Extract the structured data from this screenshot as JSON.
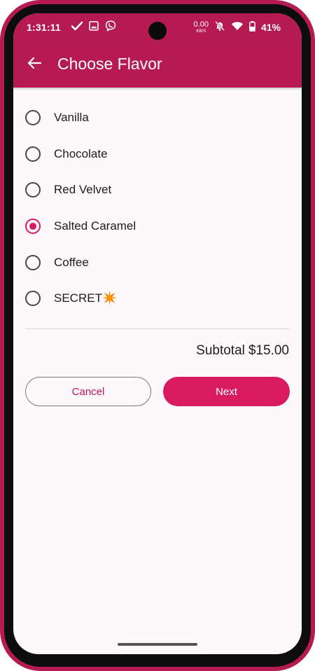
{
  "status_bar": {
    "time": "1:31:11",
    "net_speed_value": "0.00",
    "net_speed_unit": "KB/S",
    "battery": "41%",
    "icons": [
      "check-icon",
      "image-icon",
      "viber-icon",
      "mute-icon",
      "wifi-icon",
      "battery-icon"
    ]
  },
  "app_bar": {
    "title": "Choose Flavor",
    "back_icon": "arrow-back-icon"
  },
  "flavors": {
    "options": [
      {
        "label": "Vanilla",
        "selected": false
      },
      {
        "label": "Chocolate",
        "selected": false
      },
      {
        "label": "Red Velvet",
        "selected": false
      },
      {
        "label": "Salted Caramel",
        "selected": true
      },
      {
        "label": "Coffee",
        "selected": false
      },
      {
        "label": "SECRET✴️",
        "selected": false
      }
    ]
  },
  "summary": {
    "subtotal_label": "Subtotal",
    "subtotal_value": "$15.00"
  },
  "actions": {
    "cancel_label": "Cancel",
    "next_label": "Next"
  },
  "colors": {
    "primary": "#b51a52",
    "accent": "#d81b60",
    "background": "#fcf8fb"
  }
}
